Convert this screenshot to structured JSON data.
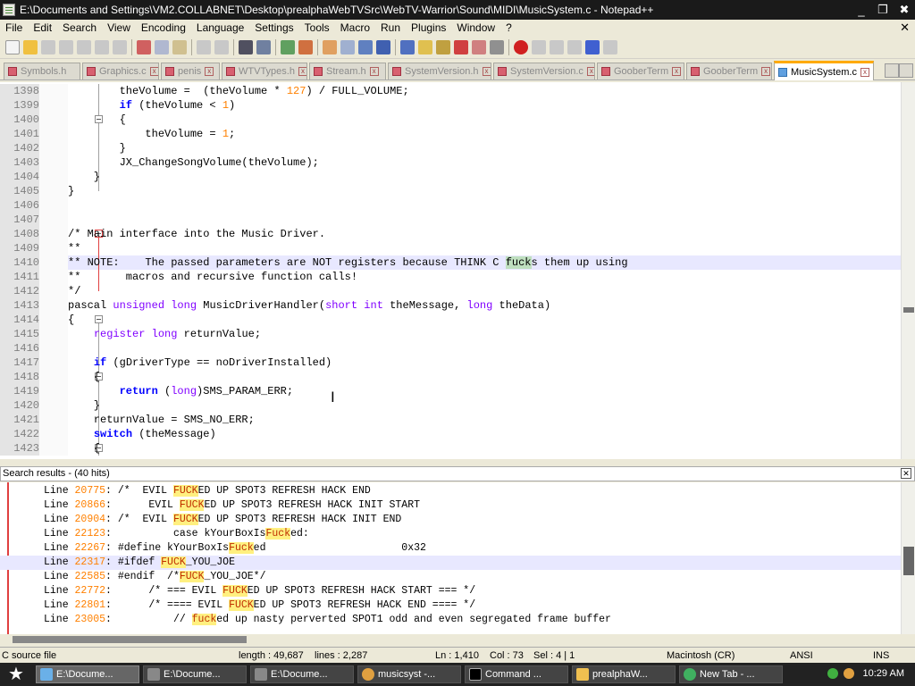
{
  "window": {
    "title": "E:\\Documents and Settings\\VM2.COLLABNET\\Desktop\\prealphaWebTVSrc\\WebTV-Warrior\\Sound\\MIDI\\MusicSystem.c - Notepad++",
    "close": "✖",
    "maximize": "❐",
    "minimize": "_"
  },
  "menu": [
    "File",
    "Edit",
    "Search",
    "View",
    "Encoding",
    "Language",
    "Settings",
    "Tools",
    "Macro",
    "Run",
    "Plugins",
    "Window",
    "?"
  ],
  "menu_close": "✕",
  "tabs": [
    {
      "label": "Symbols.h",
      "active": false
    },
    {
      "label": "Graphics.c",
      "active": false
    },
    {
      "label": "penis",
      "active": false
    },
    {
      "label": "WTVTypes.h",
      "active": false
    },
    {
      "label": "Stream.h",
      "active": false
    },
    {
      "label": "SystemVersion.h",
      "active": false
    },
    {
      "label": "SystemVersion.c",
      "active": false
    },
    {
      "label": "GooberTerm",
      "active": false
    },
    {
      "label": "GooberTerm",
      "active": false
    },
    {
      "label": "MusicSystem.c",
      "active": true
    }
  ],
  "editor": {
    "lines": [
      {
        "n": "1398",
        "t": "\t\ttheVolume =  (theVolume * 127) / FULL_VOLUME;"
      },
      {
        "n": "1399",
        "t": "\t\tif (theVolume < 1)"
      },
      {
        "n": "1400",
        "t": "\t\t{"
      },
      {
        "n": "1401",
        "t": "\t\t\ttheVolume = 1;"
      },
      {
        "n": "1402",
        "t": "\t\t}"
      },
      {
        "n": "1403",
        "t": "\t\tJX_ChangeSongVolume(theVolume);"
      },
      {
        "n": "1404",
        "t": "\t}"
      },
      {
        "n": "1405",
        "t": "}"
      },
      {
        "n": "1406",
        "t": ""
      },
      {
        "n": "1407",
        "t": ""
      },
      {
        "n": "1408",
        "t": "/* Main interface into the Music Driver."
      },
      {
        "n": "1409",
        "t": "**"
      },
      {
        "n": "1410",
        "t": "** NOTE:    The passed parameters are NOT registers because THINK C fucks them up using"
      },
      {
        "n": "1411",
        "t": "**       macros and recursive function calls!"
      },
      {
        "n": "1412",
        "t": "*/"
      },
      {
        "n": "1413",
        "t": "pascal unsigned long MusicDriverHandler(short int theMessage, long theData)"
      },
      {
        "n": "1414",
        "t": "{"
      },
      {
        "n": "1415",
        "t": "\tregister long returnValue;"
      },
      {
        "n": "1416",
        "t": ""
      },
      {
        "n": "1417",
        "t": "\tif (gDriverType == noDriverInstalled)"
      },
      {
        "n": "1418",
        "t": "\t{"
      },
      {
        "n": "1419",
        "t": "\t\treturn (long)SMS_PARAM_ERR;"
      },
      {
        "n": "1420",
        "t": "\t}"
      },
      {
        "n": "1421",
        "t": "\treturnValue = SMS_NO_ERR;"
      },
      {
        "n": "1422",
        "t": "\tswitch (theMessage)"
      },
      {
        "n": "1423",
        "t": "\t{"
      }
    ]
  },
  "search": {
    "header": "Search results - (40 hits)",
    "close": "✕",
    "results": [
      {
        "line": "20775",
        "text": "/*  EVIL FUCKED UP SPOT3 REFRESH HACK END"
      },
      {
        "line": "20866",
        "text": "     EVIL FUCKED UP SPOT3 REFRESH HACK INIT START"
      },
      {
        "line": "20904",
        "text": "/*  EVIL FUCKED UP SPOT3 REFRESH HACK INIT END"
      },
      {
        "line": "22123",
        "text": "         case kYourBoxIsFucked:"
      },
      {
        "line": "22267",
        "text": "#define kYourBoxIsFucked                      0x32"
      },
      {
        "line": "22317",
        "text": "#ifdef FUCK_YOU_JOE"
      },
      {
        "line": "22585",
        "text": "#endif  /*FUCK_YOU_JOE*/"
      },
      {
        "line": "22772",
        "text": "     /* === EVIL FUCKED UP SPOT3 REFRESH HACK START === */"
      },
      {
        "line": "22801",
        "text": "     /* ==== EVIL FUCKED UP SPOT3 REFRESH HACK END ==== */"
      },
      {
        "line": "23005",
        "text": "         // fucked up nasty perverted SPOT1 odd and even segregated frame buffer"
      }
    ]
  },
  "status": {
    "filetype": "C source file",
    "length": "length : 49,687",
    "lines": "lines : 2,287",
    "pos": "Ln : 1,410",
    "col": "Col : 73",
    "sel": "Sel : 4 | 1",
    "eol": "Macintosh (CR)",
    "enc": "ANSI",
    "mode": "INS"
  },
  "taskbar": {
    "tasks": [
      {
        "label": "E:\\Docume...",
        "active": true
      },
      {
        "label": "E:\\Docume...",
        "active": false
      },
      {
        "label": "E:\\Docume...",
        "active": false
      },
      {
        "label": "musicsyst -...",
        "active": false
      },
      {
        "label": "Command ...",
        "active": false
      },
      {
        "label": "prealphaW...",
        "active": false
      },
      {
        "label": "New Tab - ...",
        "active": false
      }
    ],
    "clock": "10:29 AM"
  }
}
